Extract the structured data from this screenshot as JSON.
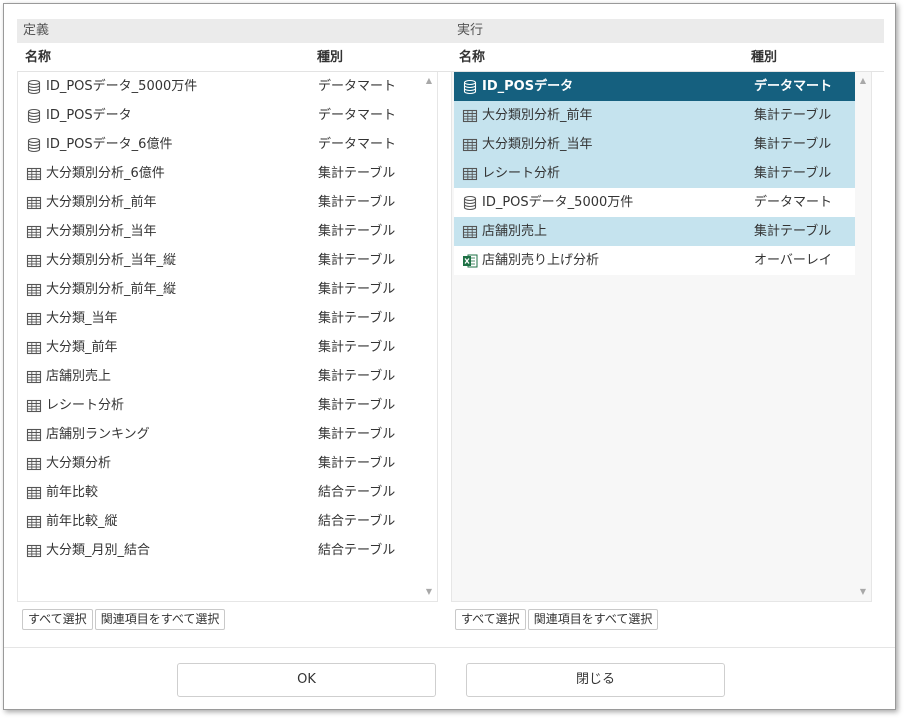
{
  "left_panel": {
    "title": "定義",
    "col_name": "名称",
    "col_type": "種別",
    "rows": [
      {
        "icon": "database-icon",
        "name": "ID_POSデータ_5000万件",
        "type": "データマート"
      },
      {
        "icon": "database-icon",
        "name": "ID_POSデータ",
        "type": "データマート"
      },
      {
        "icon": "database-icon",
        "name": "ID_POSデータ_6億件",
        "type": "データマート"
      },
      {
        "icon": "table-icon",
        "name": "大分類別分析_6億件",
        "type": "集計テーブル"
      },
      {
        "icon": "table-icon",
        "name": "大分類別分析_前年",
        "type": "集計テーブル"
      },
      {
        "icon": "table-icon",
        "name": "大分類別分析_当年",
        "type": "集計テーブル"
      },
      {
        "icon": "table-icon",
        "name": "大分類別分析_当年_縦",
        "type": "集計テーブル"
      },
      {
        "icon": "table-icon",
        "name": "大分類別分析_前年_縦",
        "type": "集計テーブル"
      },
      {
        "icon": "table-icon",
        "name": "大分類_当年",
        "type": "集計テーブル"
      },
      {
        "icon": "table-icon",
        "name": "大分類_前年",
        "type": "集計テーブル"
      },
      {
        "icon": "table-icon",
        "name": "店舗別売上",
        "type": "集計テーブル"
      },
      {
        "icon": "table-icon",
        "name": "レシート分析",
        "type": "集計テーブル"
      },
      {
        "icon": "table-icon",
        "name": "店舗別ランキング",
        "type": "集計テーブル"
      },
      {
        "icon": "table-icon",
        "name": "大分類分析",
        "type": "集計テーブル"
      },
      {
        "icon": "table-icon",
        "name": "前年比較",
        "type": "結合テーブル"
      },
      {
        "icon": "table-icon",
        "name": "前年比較_縦",
        "type": "結合テーブル"
      },
      {
        "icon": "table-icon",
        "name": "大分類_月別_結合",
        "type": "結合テーブル"
      }
    ],
    "select_all": "すべて選択",
    "select_related": "関連項目をすべて選択"
  },
  "right_panel": {
    "title": "実行",
    "col_name": "名称",
    "col_type": "種別",
    "rows": [
      {
        "icon": "database-icon",
        "name": "ID_POSデータ",
        "type": "データマート",
        "state": "active"
      },
      {
        "icon": "table-icon",
        "name": "大分類別分析_前年",
        "type": "集計テーブル",
        "state": "selected"
      },
      {
        "icon": "table-icon",
        "name": "大分類別分析_当年",
        "type": "集計テーブル",
        "state": "selected"
      },
      {
        "icon": "table-icon",
        "name": "レシート分析",
        "type": "集計テーブル",
        "state": "selected"
      },
      {
        "icon": "database-icon",
        "name": "ID_POSデータ_5000万件",
        "type": "データマート",
        "state": "normal"
      },
      {
        "icon": "table-icon",
        "name": "店舗別売上",
        "type": "集計テーブル",
        "state": "selected"
      },
      {
        "icon": "excel-icon",
        "name": "店舗別売り上げ分析",
        "type": "オーバーレイ",
        "state": "normal"
      }
    ],
    "select_all": "すべて選択",
    "select_related": "関連項目をすべて選択"
  },
  "footer": {
    "ok_label": "OK",
    "close_label": "閉じる"
  },
  "colors": {
    "active_row": "#15607f",
    "selected_row": "#c5e3ee",
    "excel_green": "#1e7145"
  }
}
